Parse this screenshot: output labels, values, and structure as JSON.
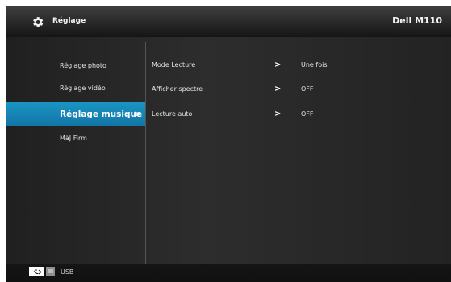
{
  "header": {
    "title": "Réglage",
    "brand": "Dell M110",
    "icon": "gear-icon"
  },
  "sidebar": {
    "items": [
      {
        "label": "Réglage photo",
        "selected": false
      },
      {
        "label": "Réglage vidéo",
        "selected": false
      },
      {
        "label": "Réglage musique",
        "selected": true
      },
      {
        "label": "MàJ Firm",
        "selected": false
      }
    ],
    "selected_chevron": ">"
  },
  "settings": {
    "rows": [
      {
        "label": "Mode Lecture",
        "arrow": ">",
        "value": "Une fois"
      },
      {
        "label": "Afficher spectre",
        "arrow": ">",
        "value": "OFF"
      },
      {
        "label": "Lecture auto",
        "arrow": ">",
        "value": "OFF"
      }
    ]
  },
  "footer": {
    "source_label": "USB",
    "icons": [
      "usb-icon",
      "drive-icon"
    ]
  },
  "colors": {
    "accent": "#1a8fc2",
    "background": "#1b1b1b",
    "text": "#e6e6e6",
    "header": "#2a2a2a"
  }
}
